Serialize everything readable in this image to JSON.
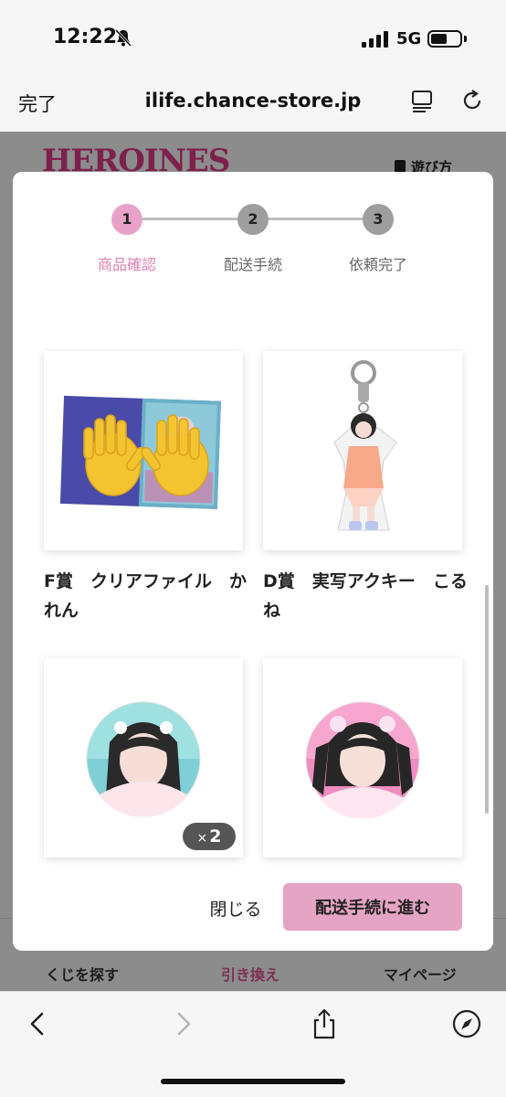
{
  "status_bar": {
    "time": "12:22",
    "network": "5G",
    "battery_level": 0.55,
    "icons": [
      "bell-slash-icon",
      "signal-icon",
      "battery-icon"
    ]
  },
  "browser": {
    "done_label": "完了",
    "url": "ilife.chance-store.jp",
    "icons": [
      "reader-icon",
      "reload-icon",
      "back-icon",
      "forward-icon",
      "share-icon",
      "compass-icon"
    ]
  },
  "page": {
    "logo_text": "HEROINES",
    "howto_label": "遊び方",
    "tabs": [
      {
        "label": "くじを探す"
      },
      {
        "label": "引き換え"
      },
      {
        "label": "マイページ"
      }
    ],
    "accent_color": "#e25a9a"
  },
  "modal": {
    "steps": [
      {
        "number": "1",
        "label": "商品確認"
      },
      {
        "number": "2",
        "label": "配送手続"
      },
      {
        "number": "3",
        "label": "依頼完了"
      }
    ],
    "active_step": 1,
    "items": [
      {
        "name": "F賞　クリアファイル　かれん",
        "image": "clear-file-image"
      },
      {
        "name": "D賞　実写アクキー　こるね",
        "image": "acrylic-keychain-image"
      },
      {
        "name": "",
        "image": "badge-image-1",
        "quantity": "2",
        "quantity_prefix": "×"
      },
      {
        "name": "",
        "image": "badge-image-2"
      }
    ],
    "close_label": "閉じる",
    "proceed_label": "配送手続に進む",
    "button_color": "#e6a4c5"
  }
}
